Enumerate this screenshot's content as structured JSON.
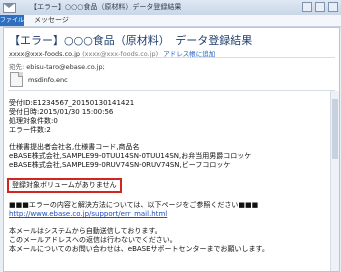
{
  "window": {
    "title_prefix": "",
    "title": "【エラー】○○○食品（原材料）データ登録結果",
    "suffix": "メッセージ (HTML)"
  },
  "ribbon": {
    "file_tab": "ファイル",
    "message_tab": "メッセージ"
  },
  "header": {
    "subject": "【エラー】○○○食品（原材料）　データ登録結果",
    "sender_email": "xxxx@xxx-foods.co.jp",
    "sender_alias": "(xxxx@xxx-foods.co.jp)",
    "add_contact": "アドレス帳に追加",
    "to_label": "宛先:",
    "to_value": "ebisu-taro@ebase.co.jp;",
    "attachment": "msdinfo.enc"
  },
  "body": {
    "receipt_id": "受付ID:E1234567_20150130141421",
    "receipt_time": "受付日時:2015/01/30 15:00:56",
    "processed_count": "処理対象件数:0",
    "error_count": "エラー件数:2",
    "table_header": "仕様書提出者会社名,仕様書コード,商品名",
    "row1": "eBASE株式会社,SAMPLE99-0TUU14SN-0TUU14SN,お弁当用男爵コロッケ",
    "row2": "eBASE株式会社,SAMPLE99-0RUV74SN-0RUV74SN,ビーフコロッケ",
    "alert": "登録対象ボリュームがありません",
    "info_line": "■■■エラーの内容と解決方法については、以下ページをご参照ください■■■",
    "info_url": "http://www.ebase.co.jp/support/err_mail.html",
    "footer1": "本メールはシステムから自動送信しております。",
    "footer2": "このメールアドレスへの返信は行わないでください。",
    "footer3": "本メールについてのお問い合わせは、eBASEサポートセンターまでお願いします。"
  }
}
